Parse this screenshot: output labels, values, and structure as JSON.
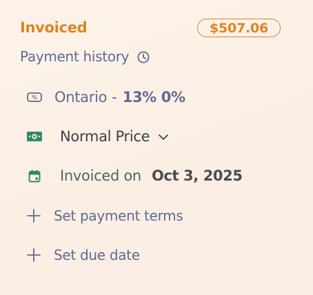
{
  "header": {
    "status": "Invoiced",
    "amount": "$507.06"
  },
  "payment_history": {
    "label": "Payment history",
    "icon": "clock-icon"
  },
  "tax": {
    "icon": "percent-tag-icon",
    "region": "Ontario",
    "separator": "-",
    "rates": "13% 0%"
  },
  "price_list": {
    "icon": "banknote-icon",
    "label": "Normal Price",
    "dropdown_icon": "chevron-down-icon"
  },
  "invoiced_on": {
    "icon": "calendar-icon",
    "label": "Invoiced on",
    "date": "Oct 3, 2025"
  },
  "actions": {
    "payment_terms": "Set payment terms",
    "due_date": "Set due date"
  },
  "colors": {
    "accent": "#d98525",
    "link": "#5d6a94",
    "green": "#2f8a6a"
  }
}
